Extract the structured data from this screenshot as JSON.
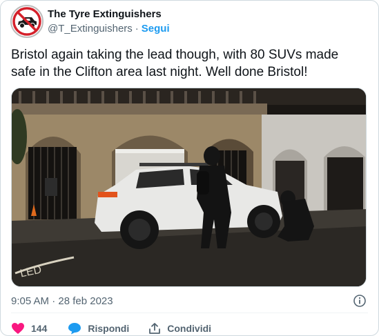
{
  "tweet": {
    "display_name": "The Tyre Extinguishers",
    "handle": "@T_Extinguishers",
    "separator": "·",
    "follow_label": "Segui",
    "text": "Bristol again taking the lead though, with 80 SUVs made safe in the Clifton area last night. Well done Bristol!",
    "timestamp": "9:05 AM · 28 feb 2023"
  },
  "actions": {
    "like_count": "144",
    "reply_label": "Rispondi",
    "share_label": "Condividi"
  },
  "colors": {
    "accent": "#1d9bf0",
    "like": "#f91880",
    "muted": "#536471"
  },
  "icons": {
    "avatar": "no-car-logo",
    "info": "info-icon",
    "like": "heart-icon",
    "reply": "speech-bubble-icon",
    "share": "share-icon"
  }
}
